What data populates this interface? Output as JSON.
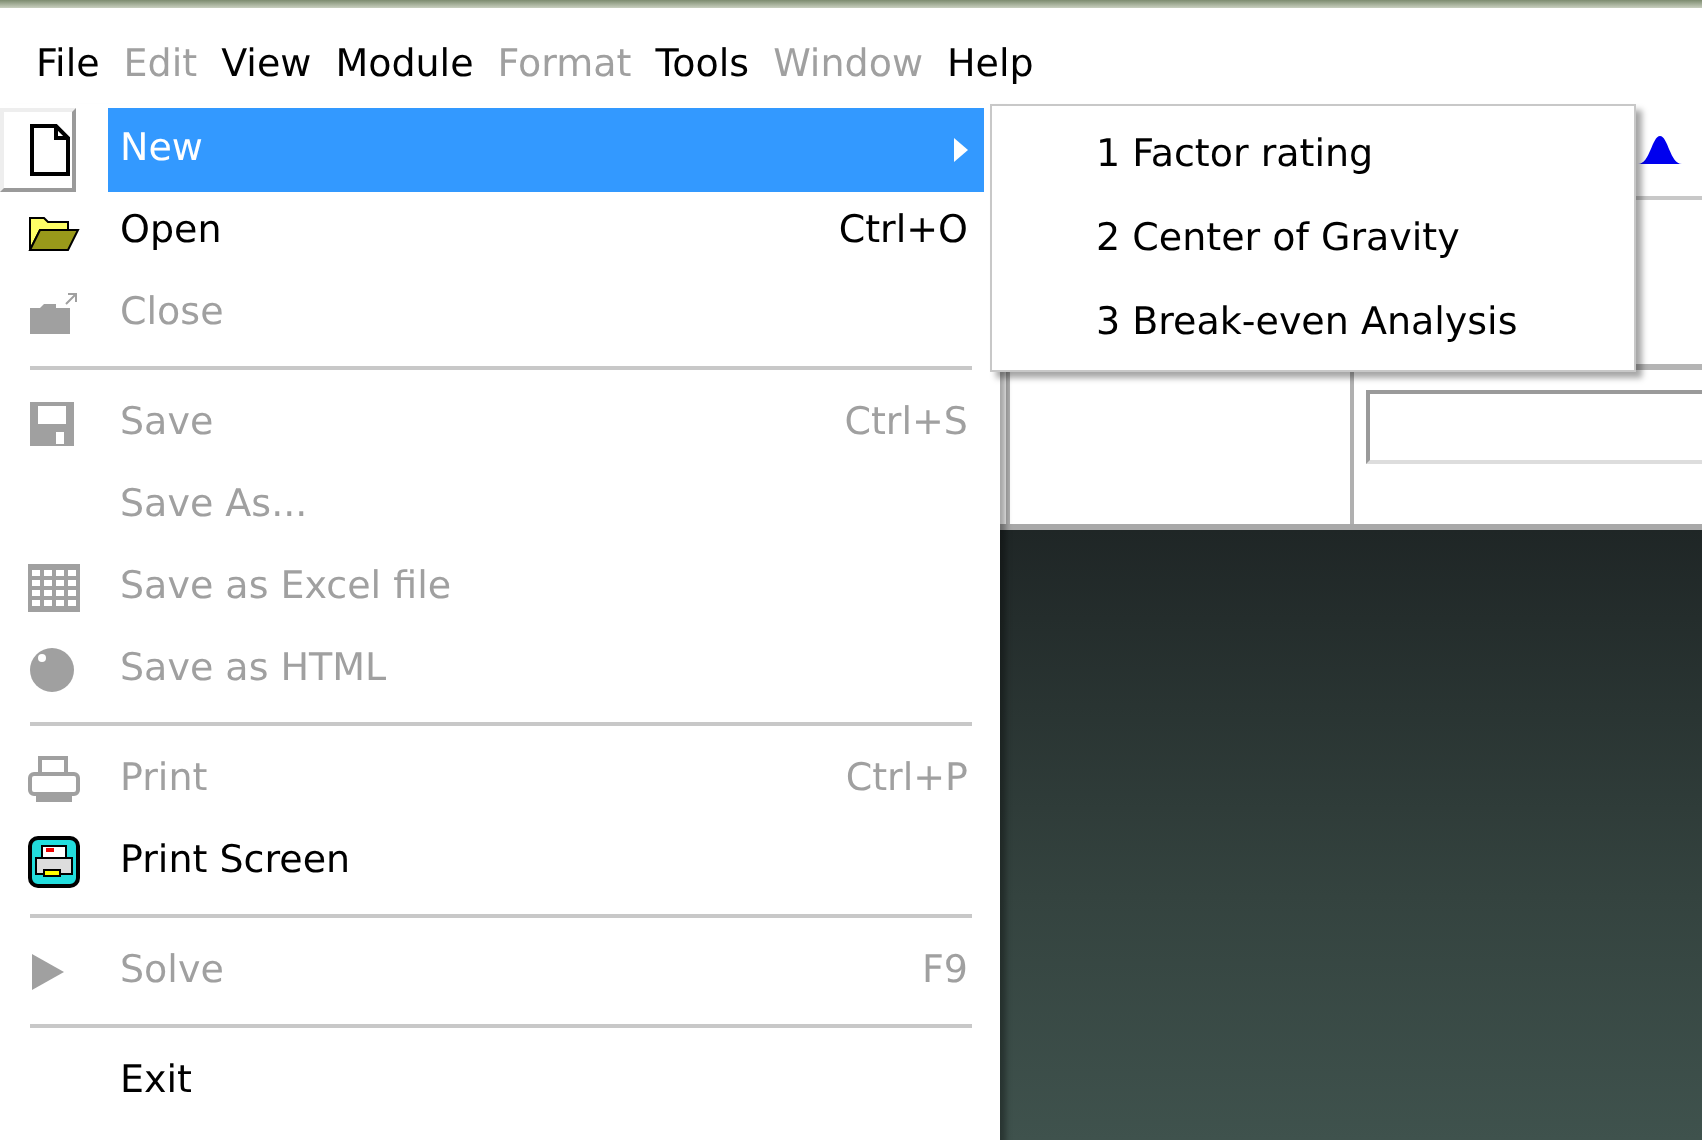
{
  "menu_bar": [
    {
      "label": "File",
      "disabled": false
    },
    {
      "label": "Edit",
      "disabled": true
    },
    {
      "label": "View",
      "disabled": false
    },
    {
      "label": "Module",
      "disabled": false
    },
    {
      "label": "Format",
      "disabled": true
    },
    {
      "label": "Tools",
      "disabled": false
    },
    {
      "label": "Window",
      "disabled": true
    },
    {
      "label": "Help",
      "disabled": false
    }
  ],
  "file_menu": {
    "items": [
      {
        "kind": "item",
        "label": "New",
        "disabled": false,
        "selected": true,
        "submenu": true
      },
      {
        "kind": "item",
        "label": "Open",
        "shortcut": "Ctrl+O",
        "disabled": false,
        "selected": false,
        "submenu": false
      },
      {
        "kind": "item",
        "label": "Close",
        "disabled": true,
        "selected": false,
        "submenu": false
      },
      {
        "kind": "separator"
      },
      {
        "kind": "item",
        "label": "Save",
        "shortcut": "Ctrl+S",
        "disabled": true,
        "selected": false,
        "submenu": false
      },
      {
        "kind": "item",
        "label": "Save As...",
        "disabled": true,
        "selected": false,
        "submenu": false
      },
      {
        "kind": "item",
        "label": "Save as Excel file",
        "disabled": true,
        "selected": false,
        "submenu": false
      },
      {
        "kind": "item",
        "label": "Save as HTML",
        "disabled": true,
        "selected": false,
        "submenu": false
      },
      {
        "kind": "separator"
      },
      {
        "kind": "item",
        "label": "Print",
        "shortcut": "Ctrl+P",
        "disabled": true,
        "selected": false,
        "submenu": false
      },
      {
        "kind": "item",
        "label": "Print Screen",
        "disabled": false,
        "selected": false,
        "submenu": false
      },
      {
        "kind": "separator"
      },
      {
        "kind": "item",
        "label": "Solve",
        "shortcut": "F9",
        "disabled": true,
        "selected": false,
        "submenu": false
      },
      {
        "kind": "separator"
      },
      {
        "kind": "item",
        "label": "Exit",
        "disabled": false,
        "selected": false,
        "submenu": false
      }
    ]
  },
  "new_submenu": {
    "items": [
      {
        "label": "1 Factor rating",
        "selected": false
      },
      {
        "label": "2 Center of Gravity",
        "selected": false
      },
      {
        "label": "3 Break-even Analysis",
        "selected": false
      }
    ]
  }
}
